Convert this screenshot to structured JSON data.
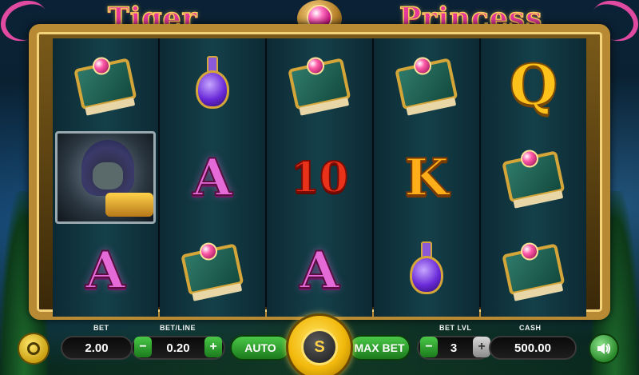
{
  "title": {
    "left_word": "Tiger",
    "right_word": "Princess"
  },
  "reels": [
    [
      "book",
      "wild",
      "A"
    ],
    [
      "potion",
      "A",
      "book"
    ],
    [
      "book",
      "10",
      "A"
    ],
    [
      "book",
      "K",
      "potion"
    ],
    [
      "Q",
      "book",
      "book"
    ]
  ],
  "controls": {
    "bet_label": "BET",
    "bet_value": "2.00",
    "betline_label": "BET/LINE",
    "betline_value": "0.20",
    "minus": "−",
    "plus": "+",
    "auto_label": "AUTO",
    "spin_label": "S",
    "maxbet_label": "MAX BET",
    "betlvl_label": "BET LVL",
    "betlvl_value": "3",
    "cash_label": "CASH",
    "cash_value": "500.00"
  },
  "colors": {
    "accent_green": "#2fa52f",
    "gold": "#f4c430",
    "title_pink": "#e6399a"
  },
  "icons": {
    "menu": "menu-icon",
    "sound": "speaker-icon"
  }
}
